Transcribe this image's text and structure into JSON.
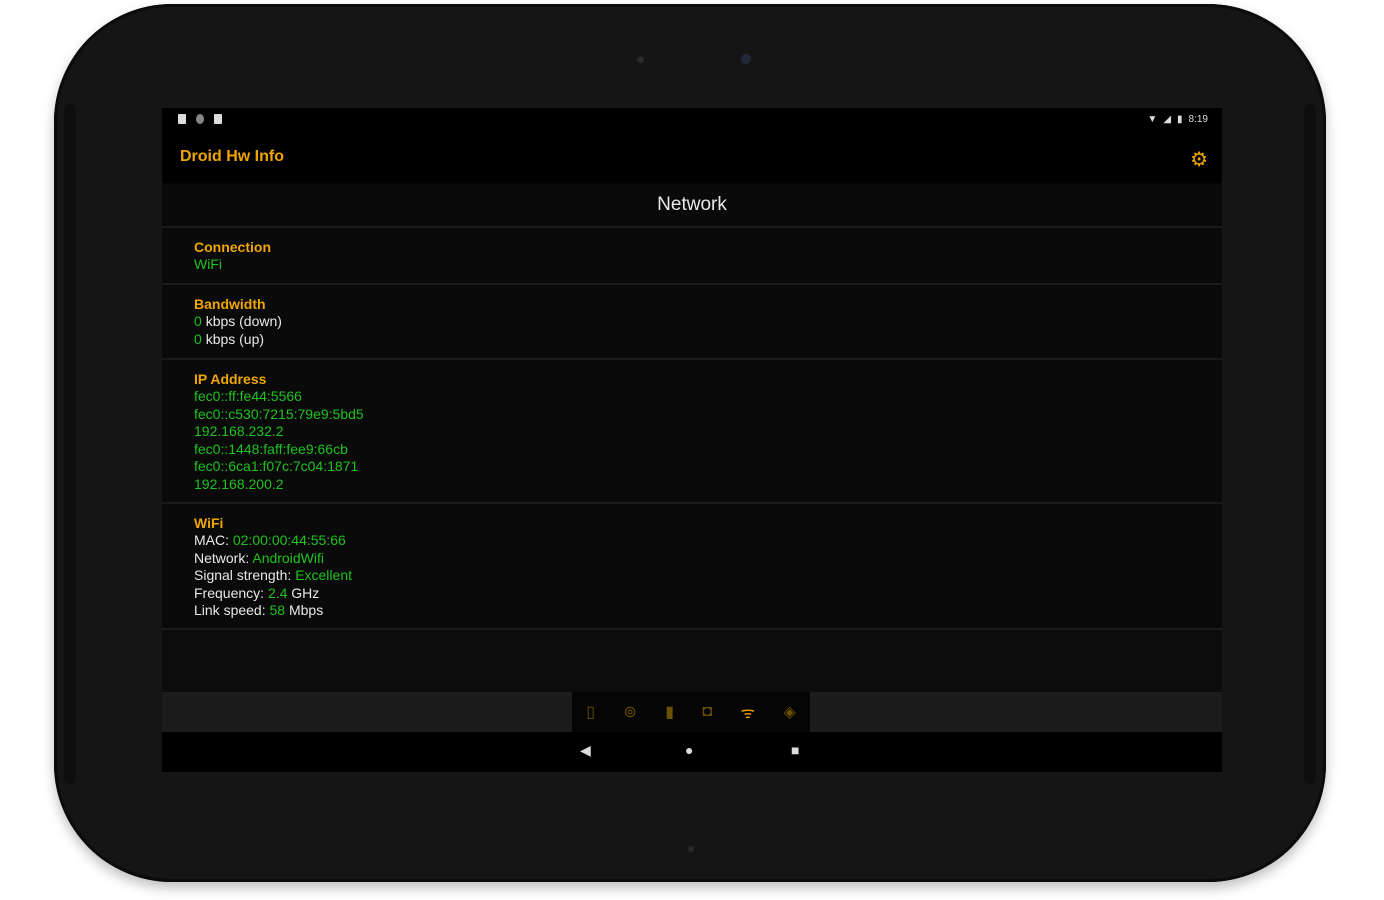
{
  "statusbar": {
    "time": "8:19",
    "wifi_icon": "wifi-icon",
    "battery_icon": "battery-icon"
  },
  "app": {
    "title": "Droid Hw Info",
    "settings_icon": "gear-icon",
    "accent": "#f0a500",
    "value_color": "#1fc21f"
  },
  "section_title": "Network",
  "connection": {
    "title": "Connection",
    "value": "WiFi"
  },
  "bandwidth": {
    "title": "Bandwidth",
    "down_value": "0",
    "down_unit": "kbps (down)",
    "up_value": "0",
    "up_unit": "kbps (up)"
  },
  "ip": {
    "title": "IP Address",
    "addresses": [
      "fec0::ff:fe44:5566",
      "fec0::c530:7215:79e9:5bd5",
      "192.168.232.2",
      "fec0::1448:faff:fee9:66cb",
      "fec0::6ca1:f07c:7c04:1871",
      "192.168.200.2"
    ]
  },
  "wifi": {
    "title": "WiFi",
    "mac_label": "MAC:",
    "mac_value": "02:00:00:44:55:66",
    "network_label": "Network:",
    "network_value": "AndroidWifi",
    "signal_label": "Signal strength:",
    "signal_value": "Excellent",
    "freq_label": "Frequency:",
    "freq_value": "2.4",
    "freq_unit": "GHz",
    "link_label": "Link speed:",
    "link_value": "58",
    "link_unit": "Mbps"
  },
  "bottom_nav": {
    "items": [
      {
        "icon": "phone-icon",
        "glyph": "▯"
      },
      {
        "icon": "cpu-icon",
        "glyph": "⊚"
      },
      {
        "icon": "battery-icon",
        "glyph": "▮"
      },
      {
        "icon": "camera-icon",
        "glyph": "◘"
      },
      {
        "icon": "wifi-icon",
        "glyph": "ᯤ"
      },
      {
        "icon": "sensor-icon",
        "glyph": "◈"
      }
    ],
    "active_index": 4
  },
  "system_nav": {
    "back": "◀",
    "home": "●",
    "recents": "■"
  }
}
